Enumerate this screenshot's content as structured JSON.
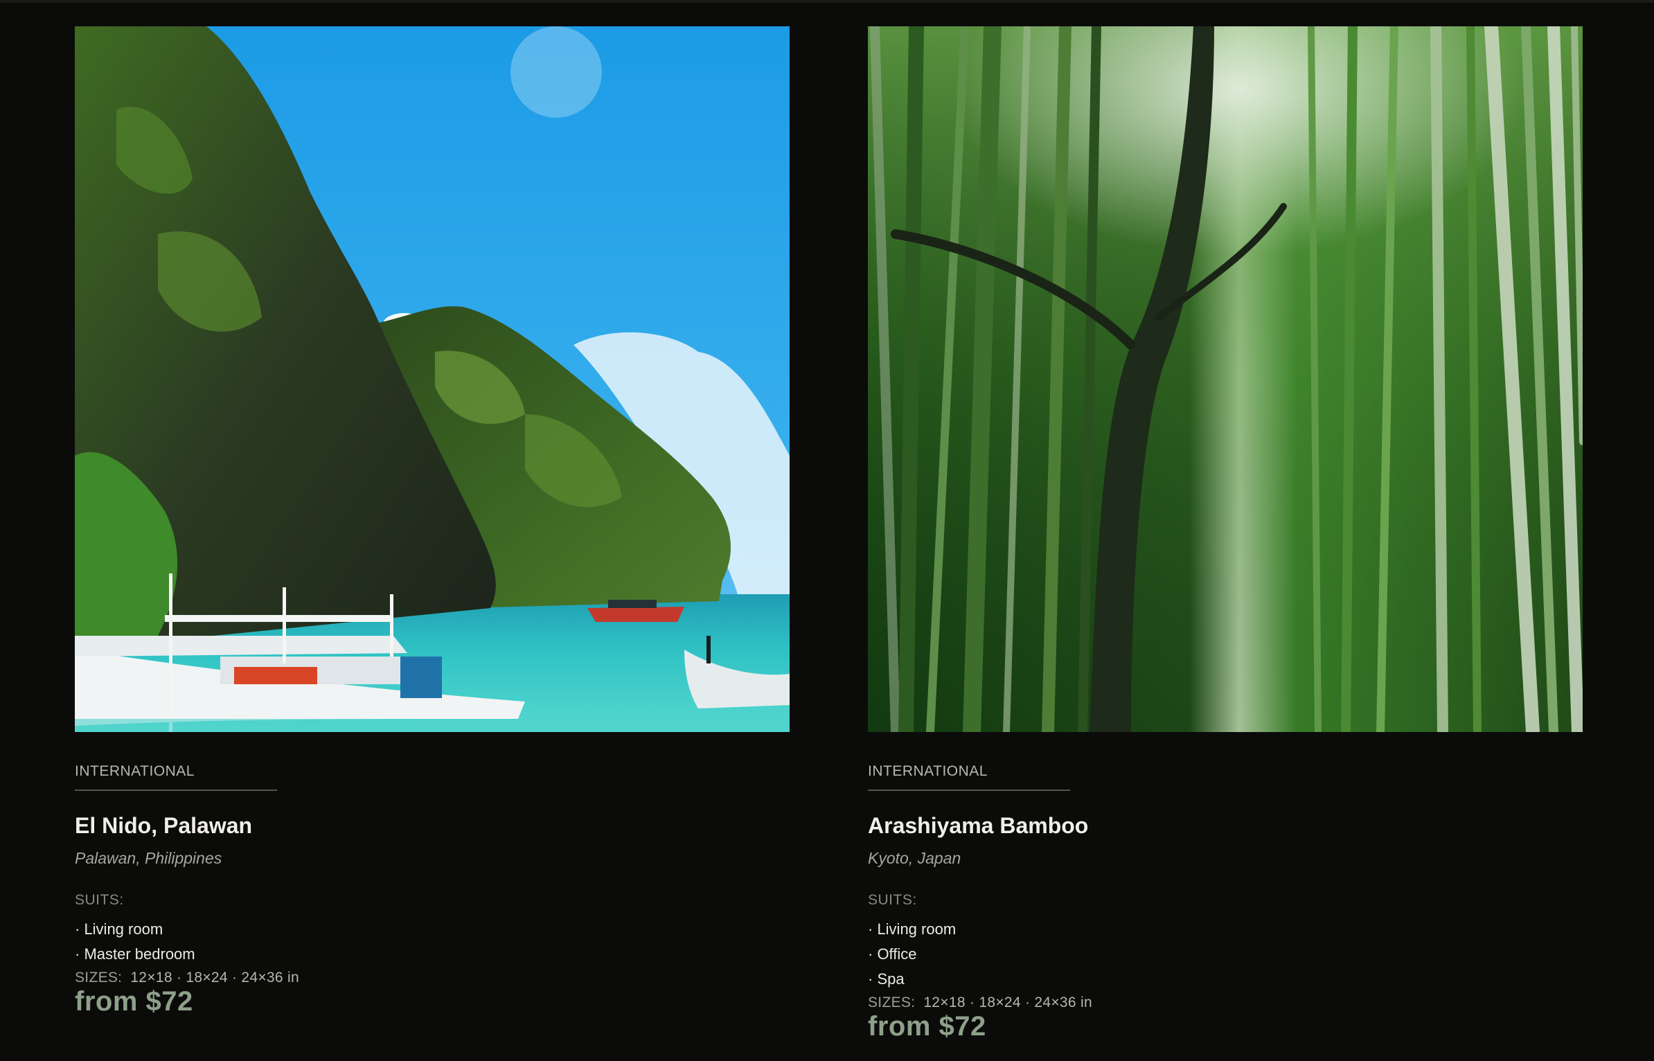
{
  "products": [
    {
      "category": "INTERNATIONAL",
      "title": "El Nido, Palawan",
      "location": "Palawan, Philippines",
      "suits_label": "SUITS:",
      "suits": [
        "· Living room",
        "· Master bedroom"
      ],
      "sizes_label": "SIZES:",
      "sizes": "12×18 · 18×24 · 24×36 in",
      "price": "from $72",
      "image": "el-nido-lagoon-photo"
    },
    {
      "category": "INTERNATIONAL",
      "title": "Arashiyama Bamboo",
      "location": "Kyoto, Japan",
      "suits_label": "SUITS:",
      "suits": [
        "· Living room",
        "· Office",
        "· Spa"
      ],
      "sizes_label": "SIZES:",
      "sizes": "12×18 · 18×24 · 24×36 in",
      "price": "from $72",
      "image": "bamboo-forest-photo"
    }
  ],
  "colors": {
    "background": "#0b0b0a",
    "price": "#8ea08a",
    "sky": "#22a3ec",
    "lagoon": "#2fc4c8",
    "bamboo": "#2f7a22"
  }
}
